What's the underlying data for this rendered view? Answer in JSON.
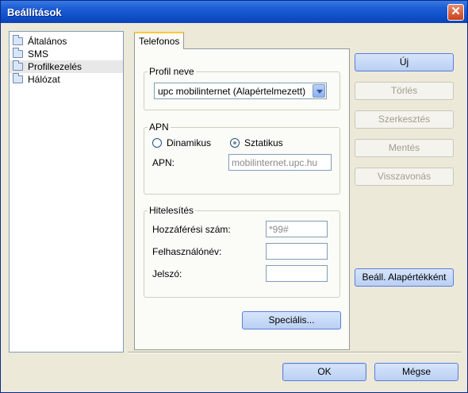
{
  "window": {
    "title": "Beállítások",
    "close_glyph": "✕"
  },
  "tree": {
    "items": [
      {
        "label": "Általános",
        "icon": "folder-icon"
      },
      {
        "label": "SMS",
        "icon": "folder-icon"
      },
      {
        "label": "Profilkezelés",
        "icon": "folder-icon",
        "selected": true
      },
      {
        "label": "Hálózat",
        "icon": "folder-icon"
      }
    ]
  },
  "tab": {
    "label": "Telefonos"
  },
  "profile": {
    "group_label": "Profil neve",
    "selected": "upc mobilinternet (Alapértelmezett)"
  },
  "apn": {
    "group_label": "APN",
    "dynamic_label": "Dinamikus",
    "static_label": "Sztatikus",
    "selected_mode": "Sztatikus",
    "field_label": "APN:",
    "field_value": "mobilinternet.upc.hu"
  },
  "auth": {
    "group_label": "Hitelesítés",
    "access_number_label": "Hozzáférési szám:",
    "access_number_value": "*99#",
    "username_label": "Felhasználónév:",
    "username_value": "",
    "password_label": "Jelszó:",
    "password_value": ""
  },
  "buttons": {
    "special": "Speciális...",
    "new": "Új",
    "delete": "Törlés",
    "edit": "Szerkesztés",
    "save": "Mentés",
    "undo": "Visszavonás",
    "set_default": "Beáll. Alapértékként",
    "ok": "OK",
    "cancel": "Mégse"
  }
}
